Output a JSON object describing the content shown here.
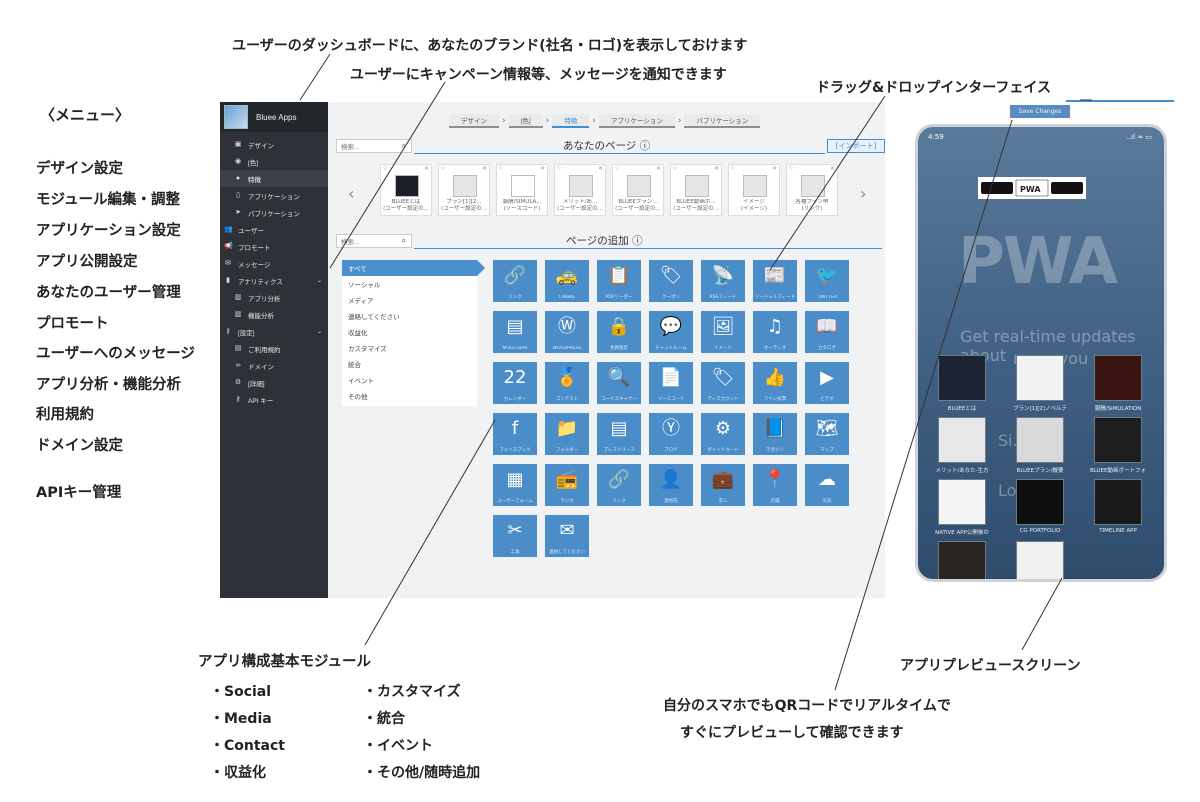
{
  "annotations": {
    "top1": "ユーザーのダッシュボードに、あなたのブランド(社名・ロゴ)を表示しておけます",
    "top2": "ユーザーにキャンペーン情報等、メッセージを通知できます",
    "top3": "ドラッグ&ドロップインターフェイス",
    "menu_title": "〈メニュー〉",
    "menu_items": [
      "デザイン設定",
      "モジュール編集・調整",
      "アプリケーション設定",
      "アプリ公開設定",
      "あなたのユーザー管理",
      "プロモート",
      "ユーザーへのメッセージ",
      "アプリ分析・機能分析",
      "利用規約",
      "ドメイン設定",
      "APIキー管理"
    ],
    "modules_title": "アプリ構成基本モジュール",
    "modules_col1": [
      "・Social",
      "・Media",
      "・Contact",
      "・収益化"
    ],
    "modules_col2": [
      "・カスタマイズ",
      "・統合",
      "・イベント",
      "・その他/随時追加"
    ],
    "qr_line1": "自分のスマホでもQRコードでリアルタイムで",
    "qr_line2": "すぐにプレビューして確認できます",
    "preview_label": "アプリプレビュースクリーン"
  },
  "app": {
    "brand_name": "Bluee Apps",
    "nav": [
      {
        "label": "デザイン",
        "icon": "design-icon",
        "level": "sub"
      },
      {
        "label": "[色]",
        "icon": "palette-icon",
        "level": "sub"
      },
      {
        "label": "特徴",
        "icon": "feature-icon",
        "level": "sub",
        "active": true
      },
      {
        "label": "アプリケーション",
        "icon": "app-icon",
        "level": "sub"
      },
      {
        "label": "パブリケーション",
        "icon": "publish-icon",
        "level": "sub"
      },
      {
        "label": "ユーザー",
        "icon": "users-icon",
        "level": "top"
      },
      {
        "label": "プロモート",
        "icon": "megaphone-icon",
        "level": "top"
      },
      {
        "label": "メッセージ",
        "icon": "mail-icon",
        "level": "top"
      },
      {
        "label": "アナリティクス",
        "icon": "chart-icon",
        "level": "top",
        "caret": true
      },
      {
        "label": "アプリ分析",
        "icon": "bar-icon",
        "level": "sub"
      },
      {
        "label": "機能分析",
        "icon": "bar-icon",
        "level": "sub"
      },
      {
        "label": "[設定]",
        "icon": "key-icon",
        "level": "top",
        "caret": true
      },
      {
        "label": "ご利用規約",
        "icon": "doc-icon",
        "level": "sub"
      },
      {
        "label": "ドメイン",
        "icon": "link-icon",
        "level": "sub"
      },
      {
        "label": "[詳細]",
        "icon": "gears-icon",
        "level": "sub"
      },
      {
        "label": "API キー",
        "icon": "key-icon",
        "level": "sub"
      }
    ],
    "breadcrumbs": [
      "デザイン",
      "[色]",
      "特徴",
      "アプリケーション",
      "パブリケーション"
    ],
    "search_placeholder": "検索...",
    "your_pages_title": "あなたのページ ⓘ",
    "import_label": "[インポート]",
    "add_page_title": "ページの追加 ⓘ",
    "pages": [
      {
        "label": "BLUEEとは",
        "sub": "(ユーザー設定の..."
      },
      {
        "label": "プラン[1][2...",
        "sub": "(ユーザー設定の..."
      },
      {
        "label": "報酬/SIMULA...",
        "sub": "(ソースコード)"
      },
      {
        "label": "メリット/あ...",
        "sub": "(ユーザー設定の..."
      },
      {
        "label": "BLUEEプラン...",
        "sub": "(ユーザー設定の..."
      },
      {
        "label": "BLUEE動画ポ...",
        "sub": "(ユーザー設定の..."
      },
      {
        "label": "イメージ",
        "sub": "(イメージ)"
      },
      {
        "label": "各種プラン申",
        "sub": "(リンク)"
      }
    ],
    "categories": [
      "すべて",
      "ソーシャル",
      "メディア",
      "連絡してください",
      "収益化",
      "カスタマイズ",
      "統合",
      "イベント",
      "その他"
    ],
    "modules": [
      {
        "glyph": "🔗",
        "label": "リンク"
      },
      {
        "glyph": "🚕",
        "label": "CABBIE"
      },
      {
        "glyph": "📋",
        "label": "PDFリーダー"
      },
      {
        "glyph": "🏷",
        "label": "クーポン"
      },
      {
        "glyph": "📡",
        "label": "RSSフィード"
      },
      {
        "glyph": "📰",
        "label": "ソーシャルフィード"
      },
      {
        "glyph": "🐦",
        "label": "TWITTER"
      },
      {
        "glyph": "▤",
        "label": "MOGG.BAR"
      },
      {
        "glyph": "Ⓦ",
        "label": "WORDPRESS"
      },
      {
        "glyph": "🔒",
        "label": "会員限定"
      },
      {
        "glyph": "💬",
        "label": "チャットルーム"
      },
      {
        "glyph": "🖼",
        "label": "イメージ"
      },
      {
        "glyph": "♫",
        "label": "オーディオ"
      },
      {
        "glyph": "📖",
        "label": "カタログ"
      },
      {
        "glyph": "22",
        "label": "カレンダー"
      },
      {
        "glyph": "🏅",
        "label": "コンテスト"
      },
      {
        "glyph": "🔍",
        "label": "コードスキャナー"
      },
      {
        "glyph": "📄",
        "label": "ソースコード"
      },
      {
        "glyph": "🏷",
        "label": "ディスカウント"
      },
      {
        "glyph": "👍",
        "label": "ファン投票"
      },
      {
        "glyph": "▶",
        "label": "ビデオ"
      },
      {
        "glyph": "f",
        "label": "フェイスブック"
      },
      {
        "glyph": "📁",
        "label": "フォルダー"
      },
      {
        "glyph": "▤",
        "label": "プレスリリース"
      },
      {
        "glyph": "Ⓨ",
        "label": "ブログ"
      },
      {
        "glyph": "⚙",
        "label": "ポイントカード"
      },
      {
        "glyph": "📘",
        "label": "マガジン"
      },
      {
        "glyph": "🗺",
        "label": "マップ"
      },
      {
        "glyph": "▦",
        "label": "ユーザーフォーム"
      },
      {
        "glyph": "📻",
        "label": "ラジオ"
      },
      {
        "glyph": "🔗",
        "label": "リンク"
      },
      {
        "glyph": "👤",
        "label": "連絡先"
      },
      {
        "glyph": "💼",
        "label": "求人"
      },
      {
        "glyph": "📍",
        "label": "店舗"
      },
      {
        "glyph": "☁",
        "label": "天気"
      },
      {
        "glyph": "✂",
        "label": "工具"
      },
      {
        "glyph": "✉",
        "label": "連絡してください"
      }
    ]
  },
  "phone": {
    "save_label": "Save Changes",
    "time": "4:59",
    "status_icons": "..ıl ≈ ▭",
    "big_text": "PWA",
    "ghost_text": "Get real-time updates about",
    "ghost_text2": "me... you",
    "ghost_sign": "Si...",
    "ghost_log": "Lo...",
    "tiles": [
      {
        "label": "BLUEEとは"
      },
      {
        "label": "プラン[1][2]ノベルテ"
      },
      {
        "label": "報酬/SIMULATION"
      },
      {
        "label": "メリット/あなた-生方"
      },
      {
        "label": "BLUEEプラン/概要"
      },
      {
        "label": "BLUEE動画ポートフォ"
      },
      {
        "label": "NATIVE APP公開後の"
      },
      {
        "label": "CG PORTFOLIO"
      },
      {
        "label": "TIMELINE APP"
      },
      {
        "label": ""
      },
      {
        "label": ""
      }
    ]
  }
}
